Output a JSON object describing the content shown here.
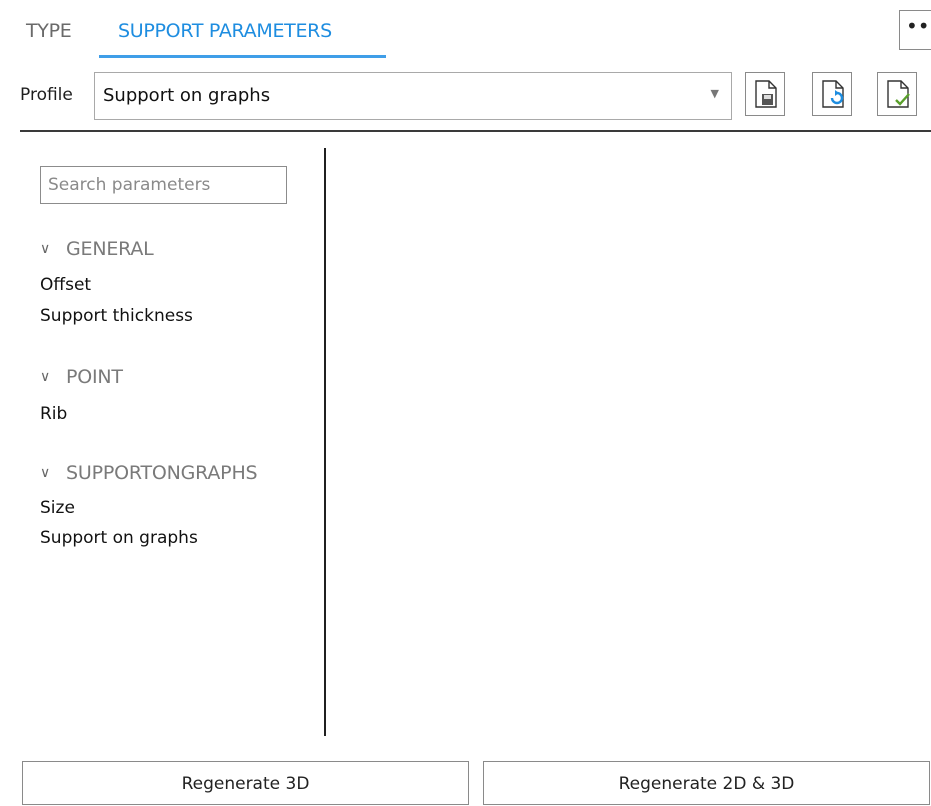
{
  "tabs": [
    {
      "label": "TYPE",
      "active": false
    },
    {
      "label": "SUPPORT PARAMETERS",
      "active": true
    }
  ],
  "more_button": {
    "label": "•••",
    "icon": "more-dots-icon"
  },
  "profile": {
    "label": "Profile",
    "selected": "Support on graphs",
    "buttons": [
      {
        "icon": "document-save-icon"
      },
      {
        "icon": "document-reload-icon"
      },
      {
        "icon": "document-check-icon"
      }
    ]
  },
  "parameters": {
    "search_placeholder": "Search parameters",
    "sections": [
      {
        "title": "GENERAL",
        "items": [
          "Offset",
          "Support thickness"
        ]
      },
      {
        "title": "POINT",
        "items": [
          "Rib"
        ]
      },
      {
        "title": "SUPPORTONGRAPHS",
        "items": [
          "Size",
          "Support on graphs"
        ]
      }
    ]
  },
  "actions": {
    "regenerate_3d": "Regenerate 3D",
    "regenerate_2d_3d": "Regenerate 2D & 3D"
  },
  "colors": {
    "accent": "#1e8de0",
    "underline": "#3f9ee8"
  }
}
